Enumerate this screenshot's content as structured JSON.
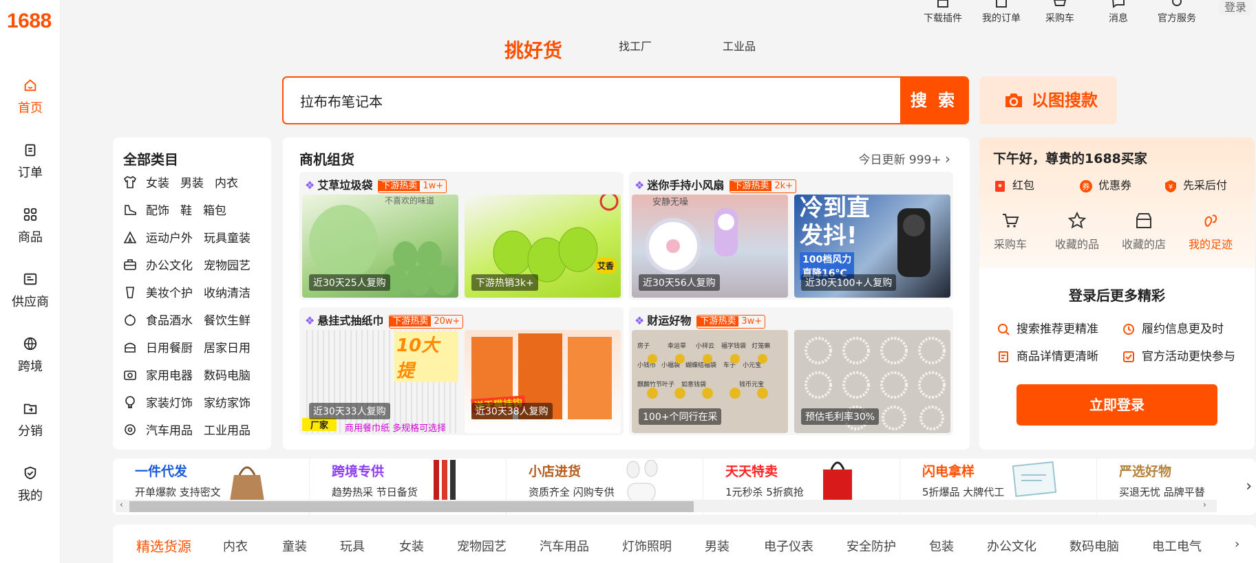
{
  "logo": "1688",
  "nav": [
    {
      "label": "首页",
      "icon": "home-icon"
    },
    {
      "label": "订单",
      "icon": "order-icon"
    },
    {
      "label": "商品",
      "icon": "grid-icon"
    },
    {
      "label": "供应商",
      "icon": "supplier-icon"
    },
    {
      "label": "跨境",
      "icon": "globe-icon"
    },
    {
      "label": "分销",
      "icon": "distribution-icon"
    },
    {
      "label": "我的",
      "icon": "user-heart-icon"
    }
  ],
  "topbar": {
    "items": [
      "下载插件",
      "我的订单",
      "采购车",
      "消息",
      "官方服务"
    ],
    "login": "登录"
  },
  "search_tabs": [
    "挑好货",
    "找工厂",
    "工业品"
  ],
  "search": {
    "value": "拉布布笔记本",
    "button": "搜 索",
    "image_search": "以图搜款"
  },
  "categories": {
    "title": "全部类目",
    "rows": [
      [
        "女装",
        "男装",
        "内衣"
      ],
      [
        "配饰",
        "鞋",
        "箱包"
      ],
      [
        "运动户外",
        "玩具童装"
      ],
      [
        "办公文化",
        "宠物园艺"
      ],
      [
        "美妆个护",
        "收纳清洁"
      ],
      [
        "食品酒水",
        "餐饮生鲜"
      ],
      [
        "日用餐厨",
        "居家日用"
      ],
      [
        "家用电器",
        "数码电脑"
      ],
      [
        "家装灯饰",
        "家纺家饰"
      ],
      [
        "汽车用品",
        "工业用品"
      ]
    ]
  },
  "deals": {
    "title": "商机组货",
    "update": "今日更新 999+",
    "items": [
      {
        "name": "艾草垃圾袋",
        "badge": "下游热卖",
        "count": "1w+",
        "captions": [
          "近30天25人复购",
          "下游热销3k+"
        ],
        "overlay": [
          "不喜欢的味道",
          "艾香"
        ]
      },
      {
        "name": "迷你手持小风扇",
        "badge": "下游热卖",
        "count": "2k+",
        "captions": [
          "近30天56人复购",
          "近30天100+人复购"
        ],
        "overlay": [
          "安静无噪",
          "冷到直",
          "发抖!",
          "100档风力",
          "直降16°C"
        ]
      },
      {
        "name": "悬挂式抽纸巾",
        "badge": "下游热卖",
        "count": "20w+",
        "captions": [
          "近30天33人复购",
          "近30天38人复购"
        ],
        "overlay": [
          "10大提",
          "商用餐巾纸 多规格可选择",
          "送天猫挂钩",
          "厂家"
        ]
      },
      {
        "name": "财运好物",
        "badge": "下游热卖",
        "count": "3w+",
        "captions": [
          "100+个同行在采",
          "预估毛利率30%"
        ],
        "overlay": [
          "房子",
          "幸运草",
          "小祥云",
          "福字钱袋",
          "灯笼嘛",
          "小钱币",
          "小福袋",
          "蝴蝶结福袋",
          "车子",
          "小元宝",
          "麒麟竹节叶子",
          "如意钱袋",
          "钱币元宝"
        ]
      }
    ]
  },
  "user": {
    "greeting": "下午好，尊贵的1688买家",
    "quick": [
      "红包",
      "优惠券",
      "先采后付"
    ],
    "links": [
      "采购车",
      "收藏的品",
      "收藏的店",
      "我的足迹"
    ],
    "more_title": "登录后更多精彩",
    "benefits": [
      "搜索推荐更精准",
      "履约信息更及时",
      "商品详情更清晰",
      "官方活动更快参与"
    ],
    "login_button": "立即登录"
  },
  "strip": [
    {
      "title": "一件代发",
      "sub": "开单爆款 支持密文",
      "color": "#1a5ad9"
    },
    {
      "title": "跨境专供",
      "sub": "趋势热采 节日备货",
      "color": "#8c3cf0"
    },
    {
      "title": "小店进货",
      "sub": "资质齐全 闪购专供",
      "color": "#b45a1a"
    },
    {
      "title": "天天特卖",
      "sub": "1元秒杀 5折疯抢",
      "color": "#ff1f1f"
    },
    {
      "title": "闪电拿样",
      "sub": "5折爆品 大牌代工",
      "color": "#ff5000"
    },
    {
      "title": "严选好物",
      "sub": "买退无忧 品牌平替",
      "color": "#b4823c"
    }
  ],
  "catbar": [
    "精选货源",
    "内衣",
    "童装",
    "玩具",
    "女装",
    "宠物园艺",
    "汽车用品",
    "灯饰照明",
    "男装",
    "电子仪表",
    "安全防护",
    "包装",
    "办公文化",
    "数码电脑",
    "电工电气"
  ],
  "colors": {
    "brand": "#ff5000"
  }
}
